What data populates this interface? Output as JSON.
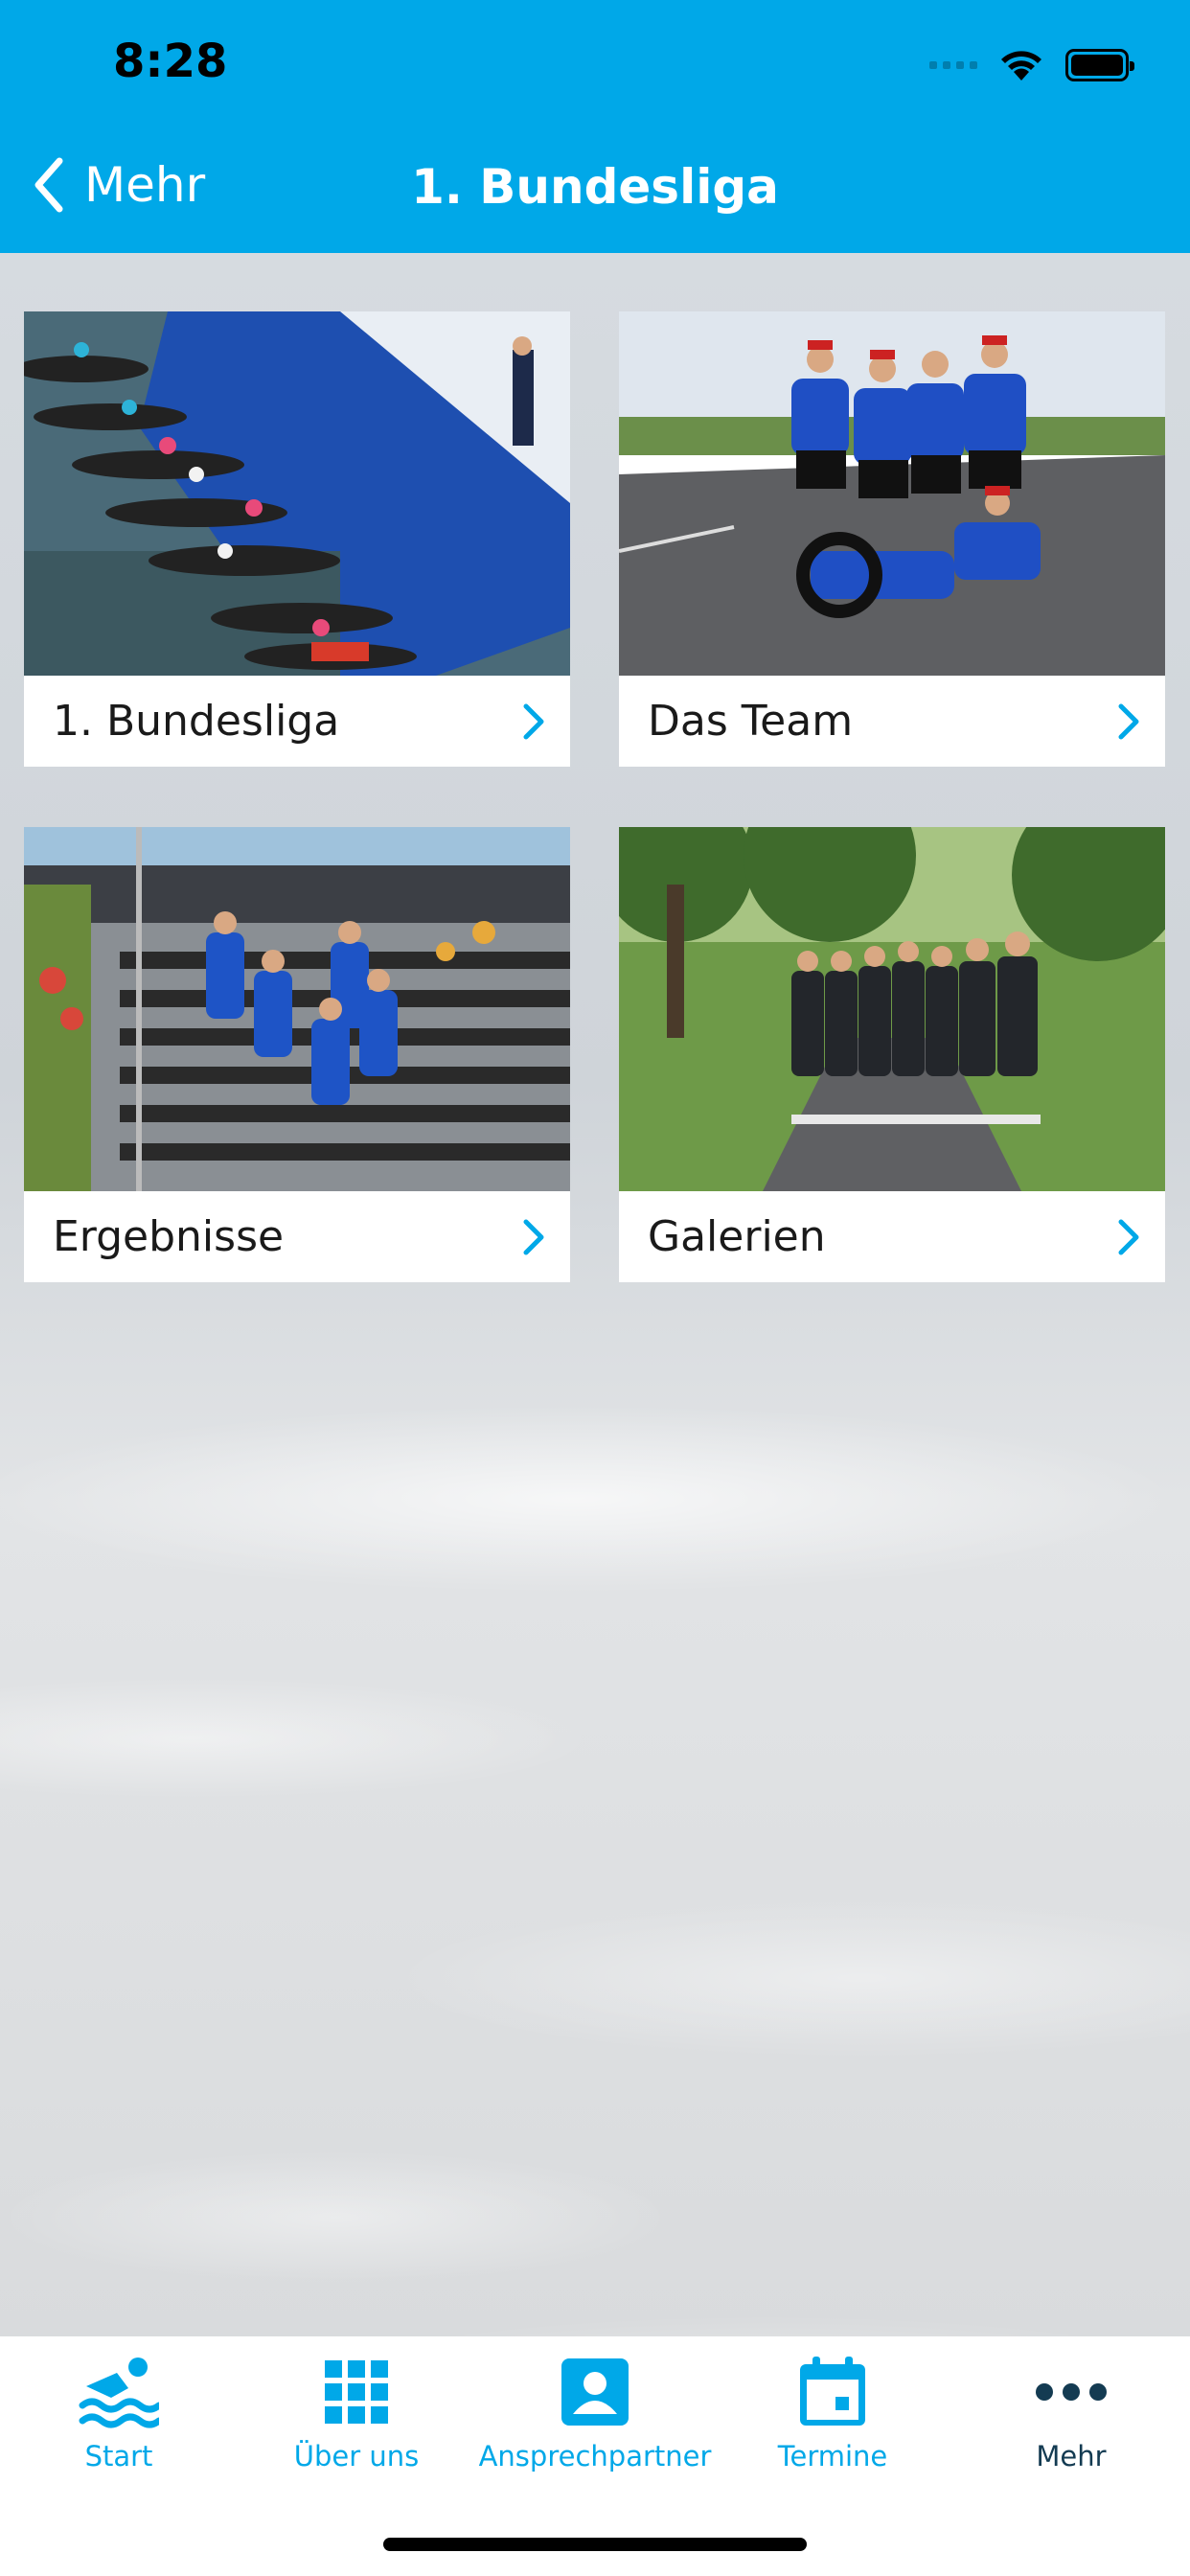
{
  "status_bar": {
    "time": "8:28"
  },
  "nav": {
    "back_label": "Mehr",
    "title": "1. Bundesliga"
  },
  "tiles": [
    {
      "label": "1. Bundesliga",
      "image": "swim-start-photo"
    },
    {
      "label": "Das Team",
      "image": "team-road-photo"
    },
    {
      "label": "Ergebnisse",
      "image": "stairs-run-photo"
    },
    {
      "label": "Galerien",
      "image": "team-trackwear-photo"
    }
  ],
  "tabbar": {
    "items": [
      {
        "label": "Start",
        "icon": "swimmer-icon"
      },
      {
        "label": "Über uns",
        "icon": "grid-icon"
      },
      {
        "label": "Ansprechpartner",
        "icon": "contact-icon"
      },
      {
        "label": "Termine",
        "icon": "calendar-icon"
      },
      {
        "label": "Mehr",
        "icon": "more-icon",
        "active": true
      }
    ]
  },
  "colors": {
    "accent": "#00a8e8",
    "active_tab": "#143b52"
  }
}
